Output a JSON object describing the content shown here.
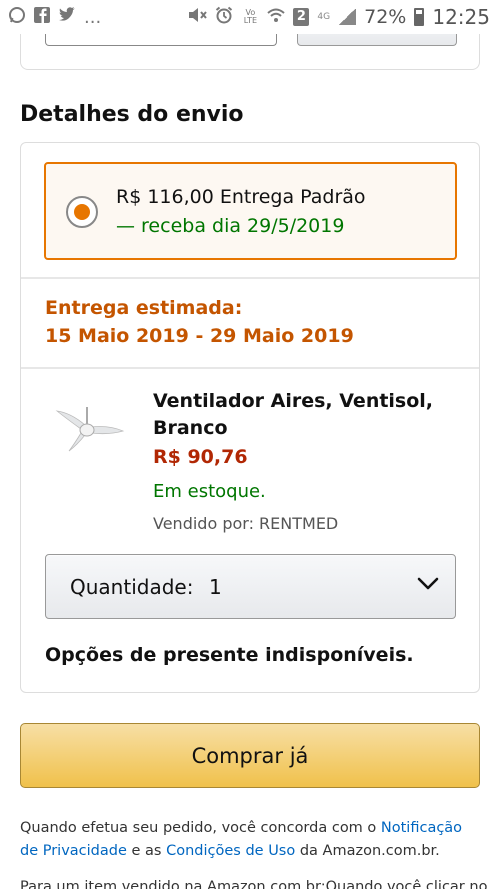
{
  "status_bar": {
    "left_icons": [
      "whatsapp-icon",
      "facebook-icon",
      "twitter-icon"
    ],
    "more": "...",
    "right_icons": [
      "mute-icon",
      "alarm-icon",
      "volte-icon",
      "wifi-icon",
      "sim2-icon",
      "4g-icon",
      "signal-icon",
      "battery-icon"
    ],
    "volte_text": "Vo LTE",
    "sim_text": "2",
    "network_text": "4G",
    "battery_percent": "72%",
    "time": "12:25"
  },
  "shipping": {
    "section_title": "Detalhes do envio",
    "option_price_label": "R$ 116,00 Entrega Padrão",
    "option_date_label": "— receba dia 29/5/2019",
    "selected": true,
    "estimate_label": "Entrega estimada:",
    "estimate_range": "15 Maio 2019 - 29 Maio 2019"
  },
  "product": {
    "image_icon": "ceiling-fan-icon",
    "title": "Ventilador Aires, Ventisol, Branco",
    "price": "R$ 90,76",
    "stock": "Em estoque.",
    "seller": "Vendido por: RENTMED"
  },
  "quantity": {
    "label": "Quantidade:",
    "value": "1"
  },
  "gift_note": "Opções de presente indisponíveis.",
  "buy_button": "Comprar já",
  "legal": {
    "p1_before": "Quando efetua seu pedido, você concorda com o ",
    "link_privacy": "Notificação de Privacidade",
    "p1_mid": " e as ",
    "link_terms": "Condições de Uso",
    "p1_after": " da Amazon.com.br.",
    "p2": "Para um item vendido na Amazon.com.br:Quando você clicar no"
  },
  "colors": {
    "accent_orange": "#e77600",
    "estimate_orange": "#c45500",
    "price_red": "#b12704",
    "stock_green": "#007600",
    "link_blue": "#0066c0",
    "buy_button_yellow": "#f0c14b"
  }
}
